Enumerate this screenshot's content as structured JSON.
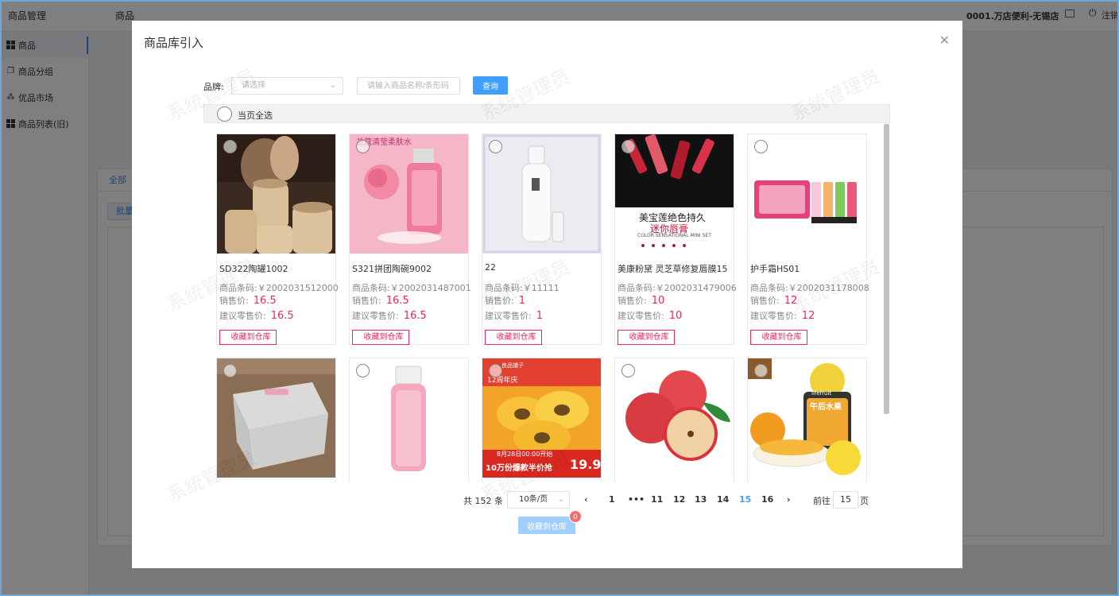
{
  "app": {
    "brand": "商品管理",
    "crumb": "商品",
    "store": "0001.万店便利-无锡店",
    "logout": "注销"
  },
  "sidebar": {
    "items": [
      {
        "label": "商品",
        "icon": "grid-icon"
      },
      {
        "label": "商品分组",
        "icon": "copy-icon"
      },
      {
        "label": "优品市场",
        "icon": "tree-icon"
      },
      {
        "label": "商品列表(旧)",
        "icon": "grid-icon"
      }
    ]
  },
  "background": {
    "tab_all": "全部",
    "batch": "批量"
  },
  "modal": {
    "title": "商品库引入",
    "filter": {
      "brand_label": "品牌:",
      "brand_placeholder": "请选择",
      "search_placeholder": "请输入商品名称/条形码",
      "query_label": "查询"
    },
    "select_all": "当页全选",
    "labels": {
      "barcode": "商品条码:",
      "sale_price": "销售价:",
      "retail_price": "建议零售价:",
      "fav": "收藏到仓库"
    },
    "products": [
      {
        "name": "SD322陶罐1002",
        "barcode": "￥2002031512000",
        "sale": "16.5",
        "retail": "16.5"
      },
      {
        "name": "S321拼团陶碗9002",
        "barcode": "￥2002031487001",
        "sale": "16.5",
        "retail": "16.5"
      },
      {
        "name": "22",
        "barcode": "￥11111",
        "sale": "1",
        "retail": "1"
      },
      {
        "name": "美康粉黛 灵芝草修复唇膜15",
        "barcode": "￥2002031479006",
        "sale": "10",
        "retail": "10"
      },
      {
        "name": "护手霜HS01",
        "barcode": "￥2002031178008",
        "sale": "12",
        "retail": "12"
      }
    ],
    "image_text": {
      "toner_title": "兰蔻清莹柔肤水",
      "lipstick_title1": "美宝莲绝色持久",
      "lipstick_title2": "迷你唇膏",
      "lipstick_sub": "COLOR SENSATIONAL MINI SET",
      "kiwi_brand": "良品铺子",
      "kiwi_anniv": "12周年庆",
      "kiwi_date": "8月28日00:00开始",
      "kiwi_promo": "10万份爆款半价抢",
      "kiwi_price": "19.9",
      "fruit_brand": "lifefruit",
      "fruit_label": "午后水果"
    },
    "pagination": {
      "total": "共 152 条",
      "page_size": "10条/页",
      "pages": [
        "1",
        "•••",
        "11",
        "12",
        "13",
        "14",
        "15",
        "16"
      ],
      "active": "15",
      "goto_label": "前往",
      "goto_value": "15",
      "goto_suffix": "页"
    },
    "bottom_button": "收藏到仓库",
    "badge": "0",
    "watermark": "系统管理员"
  }
}
